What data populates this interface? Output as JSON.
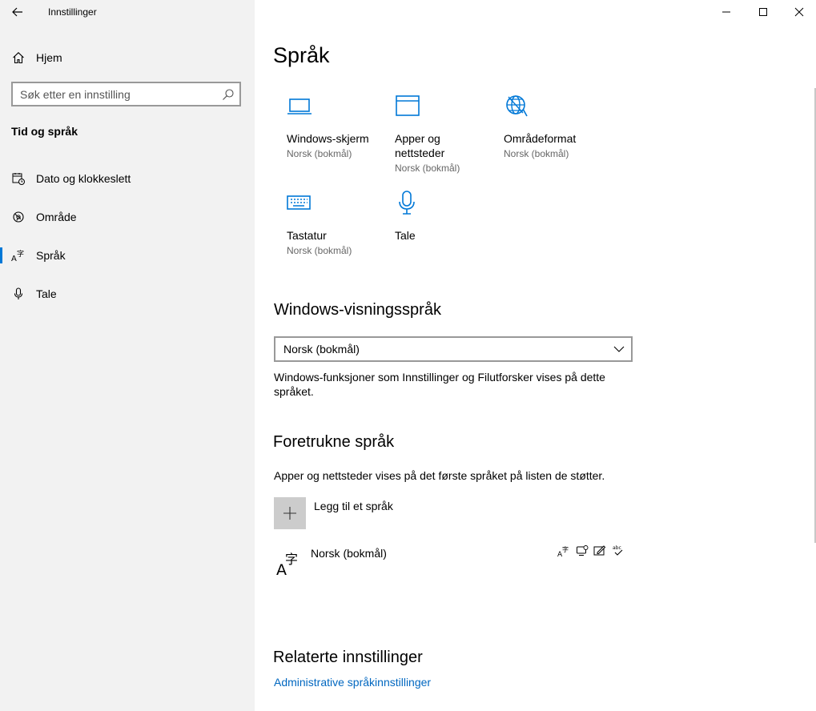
{
  "window": {
    "title": "Innstillinger",
    "controls": {
      "minimize": "minimize-icon",
      "maximize": "maximize-icon",
      "close": "close-icon"
    }
  },
  "sidebar": {
    "home_label": "Hjem",
    "search_placeholder": "Søk etter en innstilling",
    "section_heading": "Tid og språk",
    "items": [
      {
        "label": "Dato og klokkeslett",
        "icon": "calendar-clock-icon"
      },
      {
        "label": "Område",
        "icon": "globe-region-icon"
      },
      {
        "label": "Språk",
        "icon": "language-icon",
        "selected": true
      },
      {
        "label": "Tale",
        "icon": "microphone-icon"
      }
    ]
  },
  "main": {
    "title": "Språk",
    "tiles": [
      {
        "name": "Windows-skjerm",
        "sub": "Norsk (bokmål)",
        "icon": "laptop-icon"
      },
      {
        "name": "Apper og nettsteder",
        "sub": "Norsk (bokmål)",
        "icon": "window-icon"
      },
      {
        "name": "Områdeformat",
        "sub": "Norsk (bokmål)",
        "icon": "globe-format-icon"
      },
      {
        "name": "Tastatur",
        "sub": "Norsk (bokmål)",
        "icon": "keyboard-icon"
      },
      {
        "name": "Tale",
        "sub": "",
        "icon": "microphone-icon"
      }
    ],
    "display_language": {
      "heading": "Windows-visningsspråk",
      "selected": "Norsk (bokmål)",
      "description": "Windows-funksjoner som Innstillinger og Filutforsker vises på dette språket."
    },
    "preferred": {
      "heading": "Foretrukne språk",
      "description": "Apper og nettsteder vises på det første språket på listen de støtter.",
      "add_label": "Legg til et språk",
      "languages": [
        {
          "name": "Norsk (bokmål)",
          "features": [
            "display-language-icon",
            "speech-icon",
            "handwriting-icon",
            "spellcheck-icon"
          ]
        }
      ]
    },
    "related": {
      "heading": "Relaterte innstillinger",
      "links": [
        "Administrative språkinnstillinger"
      ]
    }
  },
  "colors": {
    "accent": "#0078d7",
    "link": "#0067c0",
    "sidebar_bg": "#f2f2f2"
  }
}
